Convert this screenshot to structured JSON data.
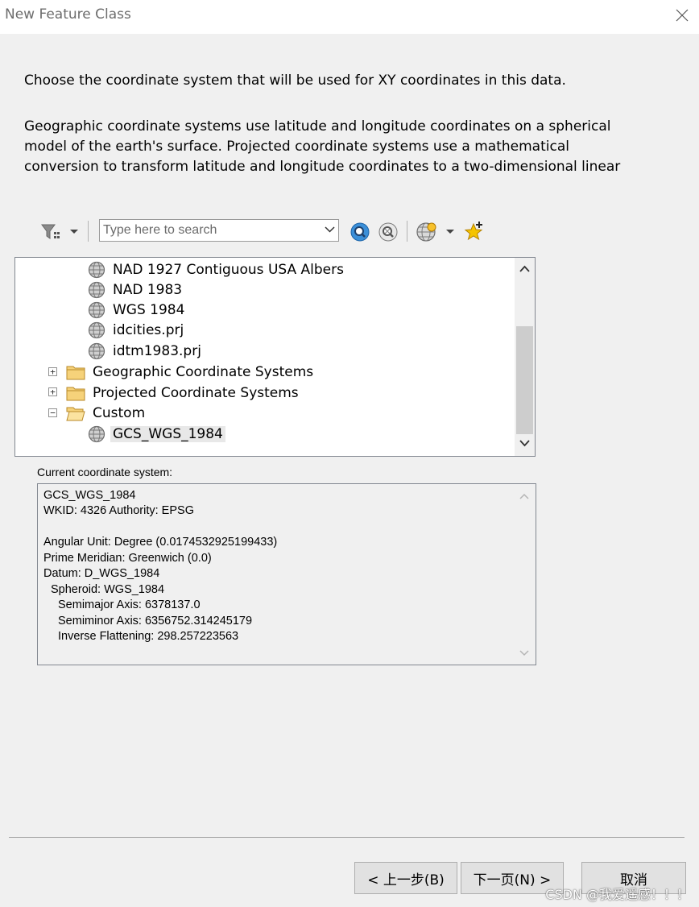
{
  "window": {
    "title": "New Feature Class"
  },
  "intro": {
    "line1": "Choose the coordinate system that will be used for XY coordinates in this data.",
    "para2_line1": "Geographic coordinate systems use latitude and longitude coordinates on a spherical",
    "para2_line2": "model of the earth's surface. Projected coordinate systems use a mathematical",
    "para2_line3": "conversion to transform latitude and longitude coordinates to a two-dimensional linear"
  },
  "toolbar": {
    "search_placeholder": "Type here to search"
  },
  "tree": {
    "items": [
      {
        "label": "NAD 1927 Contiguous USA Albers",
        "kind": "globe"
      },
      {
        "label": "NAD 1983",
        "kind": "globe"
      },
      {
        "label": "WGS 1984",
        "kind": "globe"
      },
      {
        "label": "idcities.prj",
        "kind": "globe"
      },
      {
        "label": "idtm1983.prj",
        "kind": "globe"
      },
      {
        "label": "Geographic Coordinate Systems",
        "kind": "folder",
        "expander": "+"
      },
      {
        "label": "Projected Coordinate Systems",
        "kind": "folder",
        "expander": "+"
      },
      {
        "label": "Custom",
        "kind": "folder-open",
        "expander": "−"
      },
      {
        "label": "GCS_WGS_1984",
        "kind": "globe",
        "selected": true
      }
    ]
  },
  "current": {
    "label": "Current coordinate system:",
    "lines": [
      "GCS_WGS_1984",
      "WKID: 4326 Authority: EPSG",
      "",
      "Angular Unit: Degree (0.0174532925199433)",
      "Prime Meridian: Greenwich (0.0)",
      "Datum: D_WGS_1984",
      "  Spheroid: WGS_1984",
      "    Semimajor Axis: 6378137.0",
      "    Semiminor Axis: 6356752.314245179",
      "    Inverse Flattening: 298.257223563"
    ]
  },
  "buttons": {
    "back": "< 上一步(B)",
    "next": "下一页(N) >",
    "cancel": "取消"
  },
  "watermark": "CSDN @我爱遥感！！！"
}
